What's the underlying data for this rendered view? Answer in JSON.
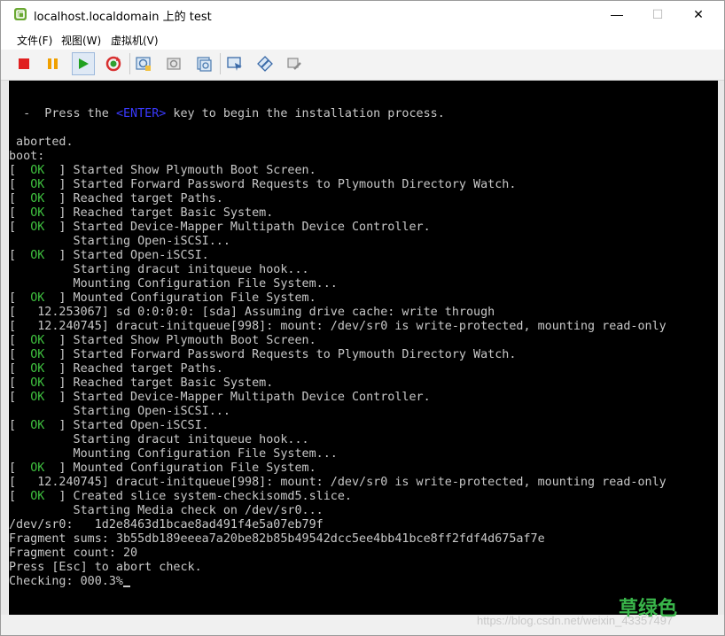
{
  "window": {
    "title": "localhost.localdomain 上的 test",
    "minimize": "—",
    "maximize": "☐",
    "close": "✕"
  },
  "menu": {
    "file": "文件(F)",
    "view": "视图(W)",
    "vm": "虚拟机(V)"
  },
  "toolbar": {
    "icons": [
      "stop-icon",
      "pause-icon",
      "play-icon",
      "reset-icon",
      "snapshot-icon",
      "revert-snapshot-icon",
      "manage-snapshots-icon",
      "devices-icon",
      "settings-icon",
      "tools-icon"
    ],
    "colors": {
      "stop": "#e02020",
      "pause": "#f0a000",
      "play": "#20a020"
    }
  },
  "console": {
    "lines": [
      [
        {
          "t": "  -  Press the "
        },
        {
          "t": "<ENTER>",
          "c": "enter"
        },
        {
          "t": " key to begin the installation process."
        }
      ],
      [
        {
          "t": ""
        }
      ],
      [
        {
          "t": " aborted."
        }
      ],
      [
        {
          "t": "boot:"
        }
      ],
      [
        {
          "t": "[  "
        },
        {
          "t": "OK",
          "c": "ok"
        },
        {
          "t": "  ] Started Show Plymouth Boot Screen."
        }
      ],
      [
        {
          "t": "[  "
        },
        {
          "t": "OK",
          "c": "ok"
        },
        {
          "t": "  ] Started Forward Password Requests to Plymouth Directory Watch."
        }
      ],
      [
        {
          "t": "[  "
        },
        {
          "t": "OK",
          "c": "ok"
        },
        {
          "t": "  ] Reached target Paths."
        }
      ],
      [
        {
          "t": "[  "
        },
        {
          "t": "OK",
          "c": "ok"
        },
        {
          "t": "  ] Reached target Basic System."
        }
      ],
      [
        {
          "t": "[  "
        },
        {
          "t": "OK",
          "c": "ok"
        },
        {
          "t": "  ] Started Device-Mapper Multipath Device Controller."
        }
      ],
      [
        {
          "t": "         Starting Open-iSCSI..."
        }
      ],
      [
        {
          "t": "[  "
        },
        {
          "t": "OK",
          "c": "ok"
        },
        {
          "t": "  ] Started Open-iSCSI."
        }
      ],
      [
        {
          "t": "         Starting dracut initqueue hook..."
        }
      ],
      [
        {
          "t": "         Mounting Configuration File System..."
        }
      ],
      [
        {
          "t": "[  "
        },
        {
          "t": "OK",
          "c": "ok"
        },
        {
          "t": "  ] Mounted Configuration File System."
        }
      ],
      [
        {
          "t": "[   12.253067] sd 0:0:0:0: [sda] Assuming drive cache: write through"
        }
      ],
      [
        {
          "t": "[   12.240745] dracut-initqueue[998]: mount: /dev/sr0 is write-protected, mounting read-only"
        }
      ],
      [
        {
          "t": "[  "
        },
        {
          "t": "OK",
          "c": "ok"
        },
        {
          "t": "  ] Started Show Plymouth Boot Screen."
        }
      ],
      [
        {
          "t": "[  "
        },
        {
          "t": "OK",
          "c": "ok"
        },
        {
          "t": "  ] Started Forward Password Requests to Plymouth Directory Watch."
        }
      ],
      [
        {
          "t": "[  "
        },
        {
          "t": "OK",
          "c": "ok"
        },
        {
          "t": "  ] Reached target Paths."
        }
      ],
      [
        {
          "t": "[  "
        },
        {
          "t": "OK",
          "c": "ok"
        },
        {
          "t": "  ] Reached target Basic System."
        }
      ],
      [
        {
          "t": "[  "
        },
        {
          "t": "OK",
          "c": "ok"
        },
        {
          "t": "  ] Started Device-Mapper Multipath Device Controller."
        }
      ],
      [
        {
          "t": "         Starting Open-iSCSI..."
        }
      ],
      [
        {
          "t": "[  "
        },
        {
          "t": "OK",
          "c": "ok"
        },
        {
          "t": "  ] Started Open-iSCSI."
        }
      ],
      [
        {
          "t": "         Starting dracut initqueue hook..."
        }
      ],
      [
        {
          "t": "         Mounting Configuration File System..."
        }
      ],
      [
        {
          "t": "[  "
        },
        {
          "t": "OK",
          "c": "ok"
        },
        {
          "t": "  ] Mounted Configuration File System."
        }
      ],
      [
        {
          "t": "[   12.240745] dracut-initqueue[998]: mount: /dev/sr0 is write-protected, mounting read-only"
        }
      ],
      [
        {
          "t": "[  "
        },
        {
          "t": "OK",
          "c": "ok"
        },
        {
          "t": "  ] Created slice system-checkisomd5.slice."
        }
      ],
      [
        {
          "t": "         Starting Media check on /dev/sr0..."
        }
      ],
      [
        {
          "t": "/dev/sr0:   1d2e8463d1bcae8ad491f4e5a07eb79f"
        }
      ],
      [
        {
          "t": "Fragment sums: 3b55db189eeea7a20be82b85b49542dcc5ee4bb41bce8ff2fdf4d675af7e"
        }
      ],
      [
        {
          "t": "Fragment count: 20"
        }
      ],
      [
        {
          "t": "Press [Esc] to abort check."
        }
      ],
      [
        {
          "t": "Checking: 000.3%"
        }
      ]
    ],
    "colors": {
      "background": "#000000",
      "text": "#c8c8c8",
      "ok": "#3fc13f",
      "enter": "#3a3aff"
    }
  },
  "watermark": {
    "label": "草绿色",
    "url": "https://blog.csdn.net/weixin_43357497"
  }
}
